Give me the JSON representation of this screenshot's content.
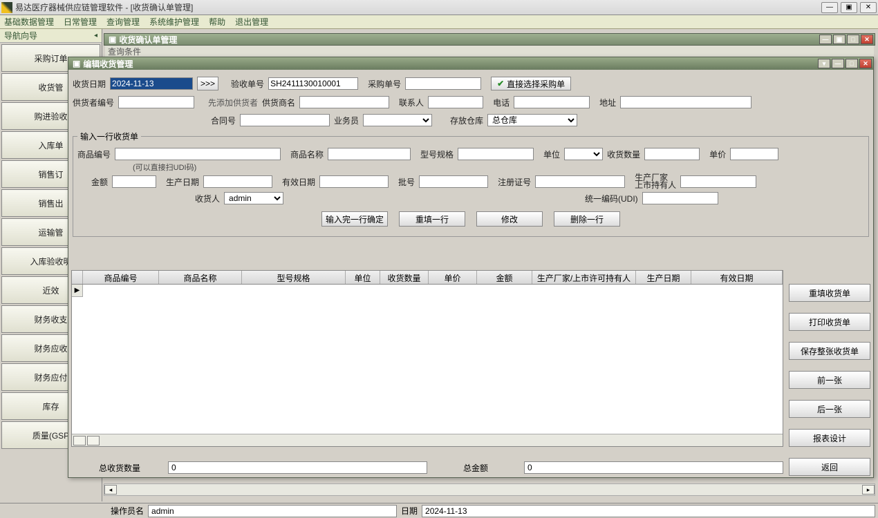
{
  "app": {
    "title": "易达医疗器械供应链管理软件 - [收货确认单管理]"
  },
  "menu": [
    "基础数据管理",
    "日常管理",
    "查询管理",
    "系统维护管理",
    "帮助",
    "退出管理"
  ],
  "nav": {
    "header": "导航向导",
    "items": [
      "采购订单",
      "收货管",
      "购进验收",
      "入库单",
      "销售订",
      "销售出",
      "运输管",
      "入库验收明",
      "近效",
      "财务收支",
      "财务应收",
      "财务应付",
      "库存",
      "质量(GSP"
    ]
  },
  "bg_window": {
    "title": "收货确认单管理",
    "query_label": "查询条件"
  },
  "dialog": {
    "title": "编辑收货管理",
    "labels": {
      "receive_date": "收货日期",
      "accept_no": "验收单号",
      "purchase_no": "采购单号",
      "direct_select": "直接选择采购单",
      "supplier_code": "供货者编号",
      "add_supplier": "先添加供货者",
      "supplier_name": "供货商名",
      "contact": "联系人",
      "phone": "电话",
      "address": "地址",
      "contract_no": "合同号",
      "salesman": "业务员",
      "warehouse": "存放仓库",
      "groupbox": "输入一行收货单",
      "product_code": "商品编号",
      "udi_hint": "(可以直接扫UDI码)",
      "product_name": "商品名称",
      "spec": "型号规格",
      "unit": "单位",
      "qty": "收货数量",
      "price": "单价",
      "amount": "金额",
      "prod_date": "生产日期",
      "valid_date": "有效日期",
      "batch": "批号",
      "reg_no": "注册证号",
      "manufacturer": "生产厂家",
      "holder": "上市持有人",
      "receiver": "收货人",
      "udi": "统一编码(UDI)"
    },
    "values": {
      "receive_date": "2024-11-13",
      "accept_no": "SH2411130010001",
      "warehouse": "总仓库",
      "receiver": "admin"
    },
    "actions": {
      "confirm_line": "输入完一行确定",
      "refill_line": "重填一行",
      "modify": "修改",
      "delete_line": "删除一行"
    },
    "grid_headers": [
      "商品编号",
      "商品名称",
      "型号规格",
      "单位",
      "收货数量",
      "单价",
      "金额",
      "生产厂家/上市许可持有人",
      "生产日期",
      "有效日期"
    ],
    "right_buttons": [
      "重填收货单",
      "打印收货单",
      "保存整张收货单",
      "前一张",
      "后一张",
      "报表设计",
      "返回"
    ],
    "totals": {
      "qty_label": "总收货数量",
      "qty_value": "0",
      "amount_label": "总金额",
      "amount_value": "0"
    }
  },
  "status": {
    "operator_label": "操作员名",
    "operator_value": "admin",
    "date_label": "日期",
    "date_value": "2024-11-13"
  }
}
